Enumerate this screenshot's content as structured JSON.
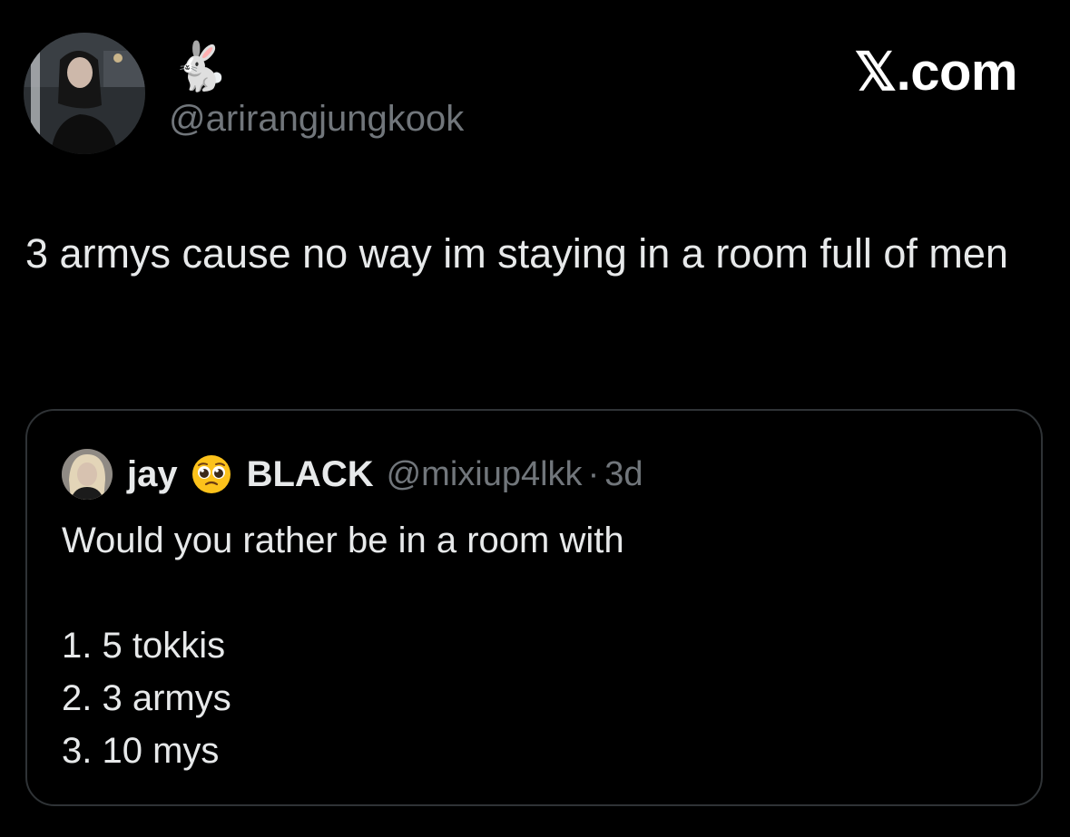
{
  "author": {
    "display_name": "🐇",
    "handle": "@arirangjungkook"
  },
  "brand": "𝕏.com",
  "tweet": {
    "text": "3 armys cause no way im staying in a room full of men"
  },
  "quote": {
    "name": "jay",
    "emoji": "pleading-face-emoji",
    "name_suffix": "BLACK",
    "handle": "@mixiup4lkk",
    "separator": "·",
    "time": "3d",
    "lines": [
      "Would you rather be in a room with",
      "",
      "1. 5 tokkis",
      "2. 3 armys",
      "3. 10 mys"
    ]
  },
  "colors": {
    "background": "#000000",
    "text": "#e7e9ea",
    "secondary_text": "#71767b",
    "card_border": "#2f3336"
  }
}
